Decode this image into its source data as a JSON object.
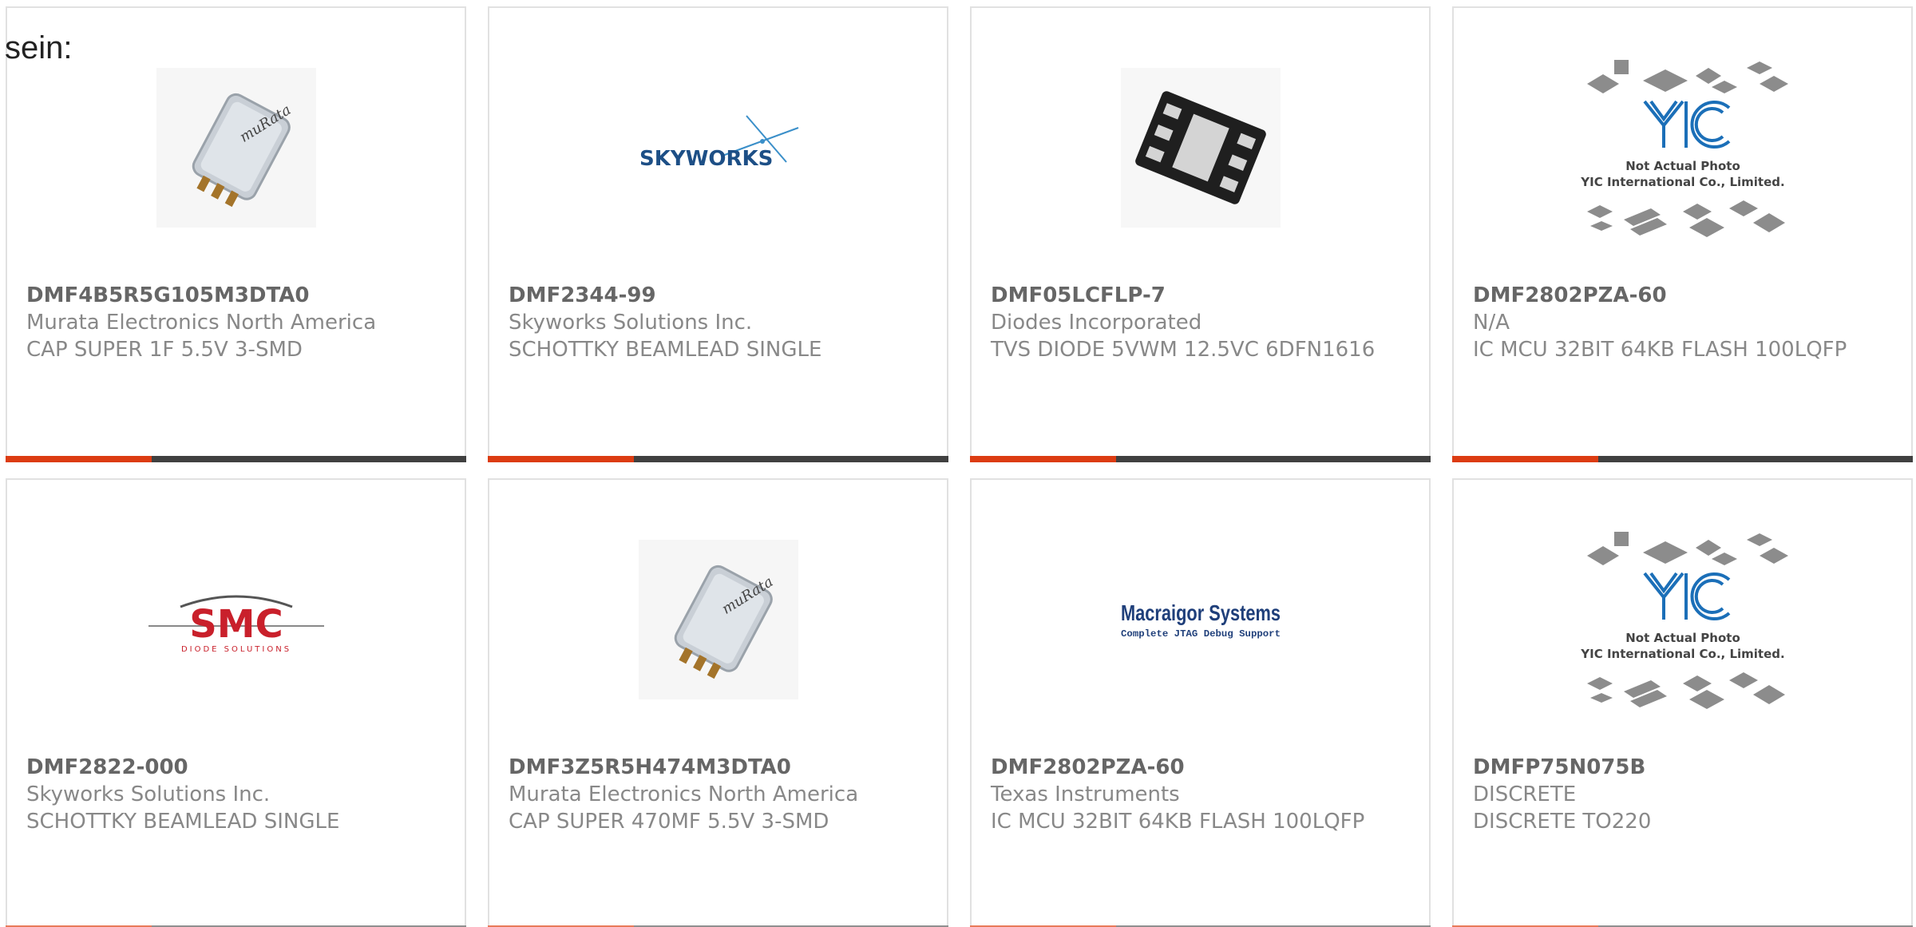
{
  "intro_text": "sein:",
  "colors": {
    "accent": "#dc3c12",
    "bar_dark": "#404040",
    "border": "#e1e1e1",
    "text": "#888888",
    "part_number": "#666666"
  },
  "products": [
    {
      "part_number": "DMF4B5R5G105M3DTA0",
      "manufacturer": "Murata Electronics North America",
      "description": "CAP SUPER 1F 5.5V 3-SMD",
      "image": "murata-supercap-photo"
    },
    {
      "part_number": "DMF2344-99",
      "manufacturer": "Skyworks Solutions Inc.",
      "description": "SCHOTTKY BEAMLEAD SINGLE",
      "image": "skyworks-logo",
      "logo_text": "SKYWORKS"
    },
    {
      "part_number": "DMF05LCFLP-7",
      "manufacturer": "Diodes Incorporated",
      "description": "TVS DIODE 5VWM 12.5VC 6DFN1616",
      "image": "dfn-package-photo"
    },
    {
      "part_number": "DMF2802PZA-60",
      "manufacturer": "N/A",
      "description": "IC MCU 32BIT 64KB FLASH 100LQFP",
      "image": "yic-placeholder",
      "placeholder_line1": "Not Actual Photo",
      "placeholder_line2": "YIC International Co., Limited."
    },
    {
      "part_number": "DMF2822-000",
      "manufacturer": "Skyworks Solutions Inc.",
      "description": "SCHOTTKY BEAMLEAD SINGLE",
      "image": "smc-logo",
      "logo_text": "SMC",
      "logo_subtext": "DIODE SOLUTIONS"
    },
    {
      "part_number": "DMF3Z5R5H474M3DTA0",
      "manufacturer": "Murata Electronics North America",
      "description": "CAP SUPER 470MF 5.5V 3-SMD",
      "image": "murata-supercap-photo"
    },
    {
      "part_number": "DMF2802PZA-60",
      "manufacturer": "Texas Instruments",
      "description": "IC MCU 32BIT 64KB FLASH 100LQFP",
      "image": "macraigor-logo",
      "logo_text": "Macraigor Systems",
      "logo_subtext": "Complete JTAG Debug Support"
    },
    {
      "part_number": "DMFP75N075B",
      "manufacturer": "DISCRETE",
      "description": "DISCRETE TO220",
      "image": "yic-placeholder",
      "placeholder_line1": "Not Actual Photo",
      "placeholder_line2": "YIC International Co., Limited."
    }
  ]
}
